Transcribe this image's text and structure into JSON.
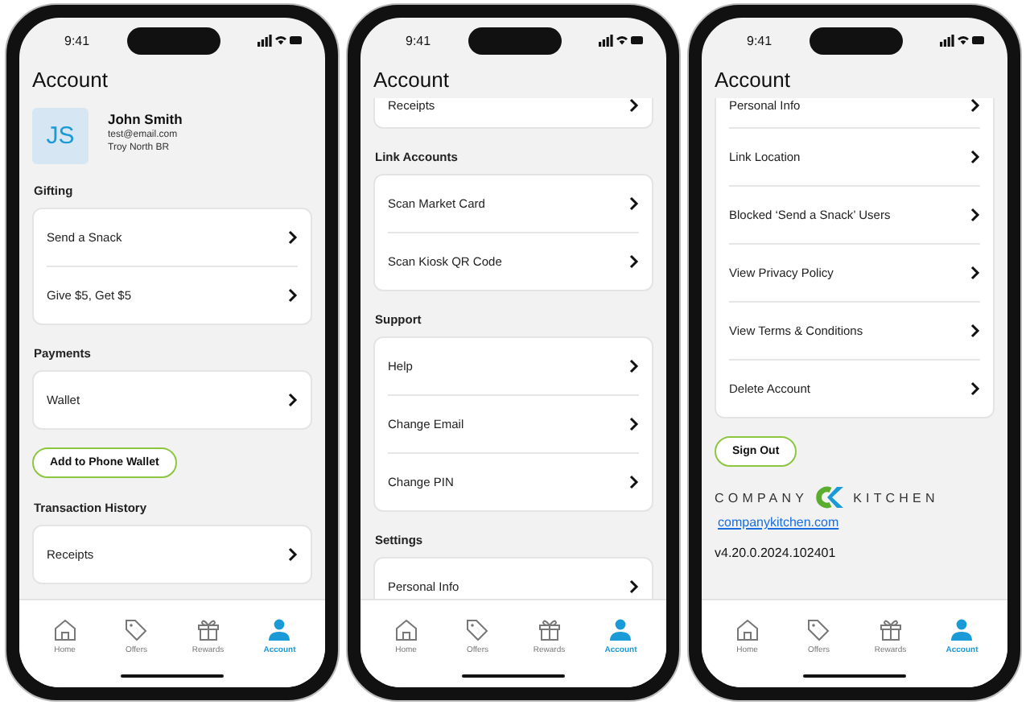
{
  "phones": [
    {
      "status_time": "9:41",
      "title": "Account",
      "blocks": [
        {
          "kind": "profile",
          "initials": "JS",
          "name": "John Smith",
          "email": "test@email.com",
          "location": "Troy North BR"
        },
        {
          "kind": "heading",
          "text": "Gifting"
        },
        {
          "kind": "card",
          "cut_top": false,
          "items": [
            "Send a Snack",
            "Give $5, Get $5"
          ]
        },
        {
          "kind": "heading",
          "text": "Payments"
        },
        {
          "kind": "card",
          "cut_top": false,
          "items": [
            "Wallet"
          ]
        },
        {
          "kind": "button",
          "text": "Add to Phone Wallet"
        },
        {
          "kind": "heading",
          "text": "Transaction History"
        },
        {
          "kind": "card",
          "cut_top": false,
          "items": [
            "Receipts"
          ]
        }
      ],
      "tabs": [
        {
          "kind": "home",
          "label": "Home",
          "selected": false
        },
        {
          "kind": "tag",
          "label": "Offers",
          "selected": false
        },
        {
          "kind": "gift",
          "label": "Rewards",
          "selected": false
        },
        {
          "kind": "person",
          "label": "Account",
          "selected": true
        }
      ]
    },
    {
      "status_time": "9:41",
      "title": "Account",
      "blocks": [
        {
          "kind": "card",
          "cut_top": true,
          "items": [
            "Receipts"
          ]
        },
        {
          "kind": "heading",
          "text": "Link Accounts"
        },
        {
          "kind": "card",
          "cut_top": false,
          "items": [
            "Scan Market Card",
            "Scan Kiosk QR Code"
          ]
        },
        {
          "kind": "heading",
          "text": "Support"
        },
        {
          "kind": "card",
          "cut_top": false,
          "items": [
            "Help",
            "Change Email",
            "Change PIN"
          ]
        },
        {
          "kind": "heading",
          "text": "Settings"
        },
        {
          "kind": "card",
          "cut_top": false,
          "items": [
            "Personal Info"
          ]
        }
      ],
      "tabs": [
        {
          "kind": "home",
          "label": "Home",
          "selected": false
        },
        {
          "kind": "tag",
          "label": "Offers",
          "selected": false
        },
        {
          "kind": "gift",
          "label": "Rewards",
          "selected": false
        },
        {
          "kind": "person",
          "label": "Account",
          "selected": true
        }
      ]
    },
    {
      "status_time": "9:41",
      "title": "Account",
      "blocks": [
        {
          "kind": "card",
          "cut_top": true,
          "items": [
            "Personal Info",
            "Link Location",
            "Blocked ‘Send a Snack’ Users",
            "View Privacy Policy",
            "View Terms & Conditions",
            "Delete Account"
          ]
        },
        {
          "kind": "button",
          "text": "Sign Out"
        },
        {
          "kind": "logo",
          "left": "COMPANY",
          "right": "KITCHEN"
        },
        {
          "kind": "link",
          "text": "companykitchen.com"
        },
        {
          "kind": "text",
          "text": "v4.20.0.2024.102401"
        }
      ],
      "tabs": [
        {
          "kind": "home",
          "label": "Home",
          "selected": false
        },
        {
          "kind": "tag",
          "label": "Offers",
          "selected": false
        },
        {
          "kind": "gift",
          "label": "Rewards",
          "selected": false
        },
        {
          "kind": "person",
          "label": "Account",
          "selected": true
        }
      ]
    }
  ]
}
